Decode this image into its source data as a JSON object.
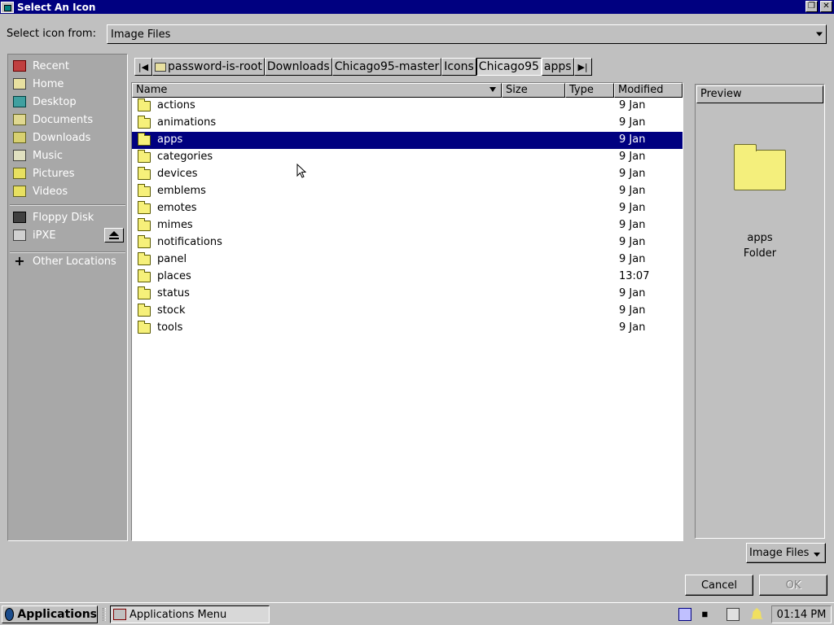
{
  "window": {
    "title": "Select An Icon",
    "restore_label": "❐",
    "close_label": "✕"
  },
  "source": {
    "label": "Select icon from:",
    "value": "Image Files"
  },
  "sidebar": {
    "items": [
      {
        "label": "Recent",
        "icon": "recent-icon"
      },
      {
        "label": "Home",
        "icon": "home-icon"
      },
      {
        "label": "Desktop",
        "icon": "desktop-icon"
      },
      {
        "label": "Documents",
        "icon": "documents-icon"
      },
      {
        "label": "Downloads",
        "icon": "downloads-icon"
      },
      {
        "label": "Music",
        "icon": "music-icon"
      },
      {
        "label": "Pictures",
        "icon": "pictures-icon"
      },
      {
        "label": "Videos",
        "icon": "videos-icon"
      }
    ],
    "devices": [
      {
        "label": "Floppy Disk",
        "icon": "floppy-icon"
      },
      {
        "label": "iPXE",
        "icon": "drive-icon"
      }
    ],
    "other": {
      "label": "Other Locations",
      "icon": "plus-icon"
    }
  },
  "path": {
    "back_label": "|◀",
    "forward_label": "▶|",
    "segments": [
      "password-is-root",
      "Downloads",
      "Chicago95-master",
      "Icons",
      "Chicago95",
      "apps"
    ],
    "active_index": 4
  },
  "files": {
    "columns": {
      "name": "Name",
      "size": "Size",
      "type": "Type",
      "modified": "Modified"
    },
    "rows": [
      {
        "name": "actions",
        "modified": "9 Jan"
      },
      {
        "name": "animations",
        "modified": "9 Jan"
      },
      {
        "name": "apps",
        "modified": "9 Jan"
      },
      {
        "name": "categories",
        "modified": "9 Jan"
      },
      {
        "name": "devices",
        "modified": "9 Jan"
      },
      {
        "name": "emblems",
        "modified": "9 Jan"
      },
      {
        "name": "emotes",
        "modified": "9 Jan"
      },
      {
        "name": "mimes",
        "modified": "9 Jan"
      },
      {
        "name": "notifications",
        "modified": "9 Jan"
      },
      {
        "name": "panel",
        "modified": "9 Jan"
      },
      {
        "name": "places",
        "modified": "13:07"
      },
      {
        "name": "status",
        "modified": "9 Jan"
      },
      {
        "name": "stock",
        "modified": "9 Jan"
      },
      {
        "name": "tools",
        "modified": "9 Jan"
      }
    ],
    "selected_index": 2
  },
  "preview": {
    "header": "Preview",
    "name": "apps",
    "kind": "Folder"
  },
  "filter": {
    "value": "Image Files"
  },
  "buttons": {
    "cancel": "Cancel",
    "ok": "OK"
  },
  "taskbar": {
    "applications": "Applications",
    "task": "Applications Menu",
    "clock": "01:14 PM"
  },
  "colors": {
    "selection": "#000080",
    "titlebar": "#000080",
    "face": "#c0c0c0",
    "sidebar": "#a8a8a8"
  }
}
